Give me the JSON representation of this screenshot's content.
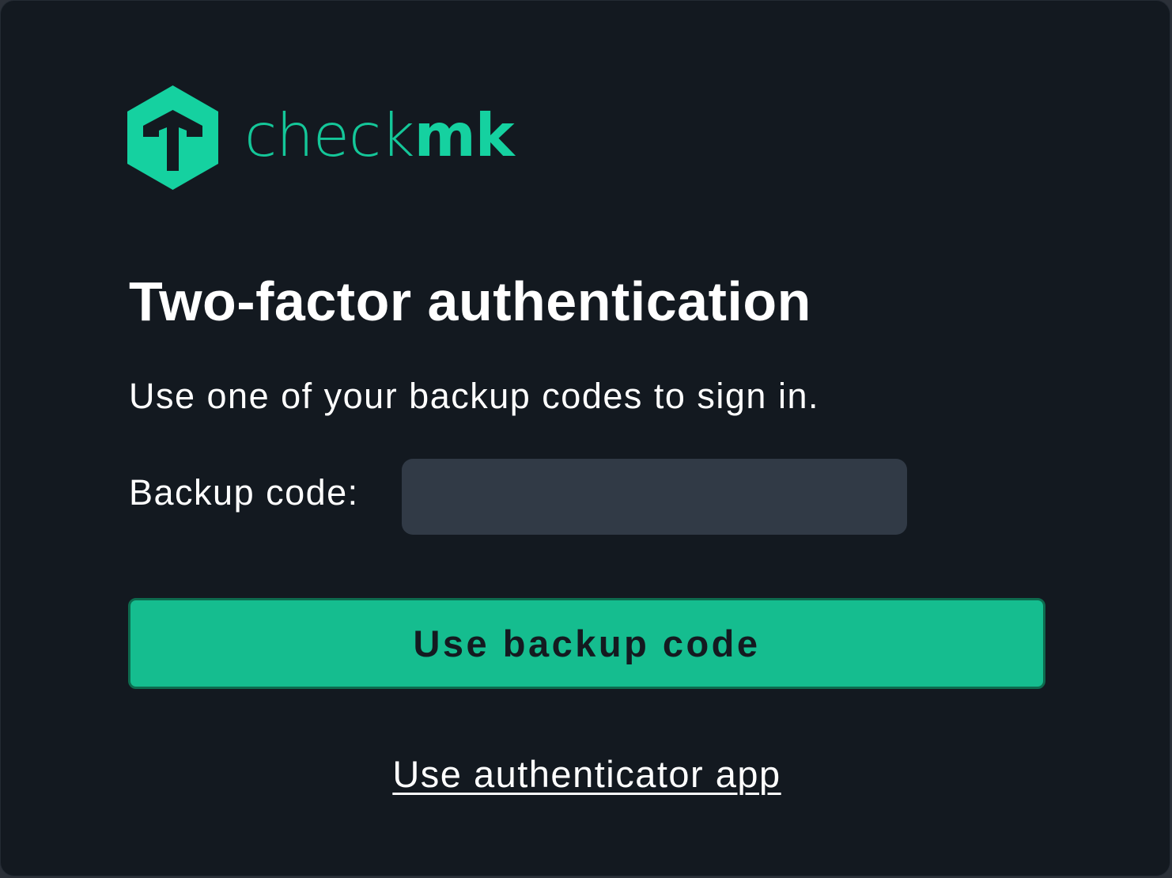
{
  "brand": {
    "name_light": "check",
    "name_bold": "mk",
    "color": "#15d1a0",
    "icon": "checkmk-hexagon-logo-icon"
  },
  "page": {
    "title": "Two-factor authentication",
    "subtitle": "Use one of your backup codes to sign in."
  },
  "form": {
    "backup_code_label": "Backup code:",
    "backup_code_value": "",
    "backup_code_placeholder": "",
    "submit_label": "Use backup code",
    "submit_color": "#15bd8f"
  },
  "links": {
    "alternate_method": "Use authenticator app"
  },
  "colors": {
    "background": "#131920",
    "input_background": "#313a46",
    "text": "#ffffff"
  }
}
